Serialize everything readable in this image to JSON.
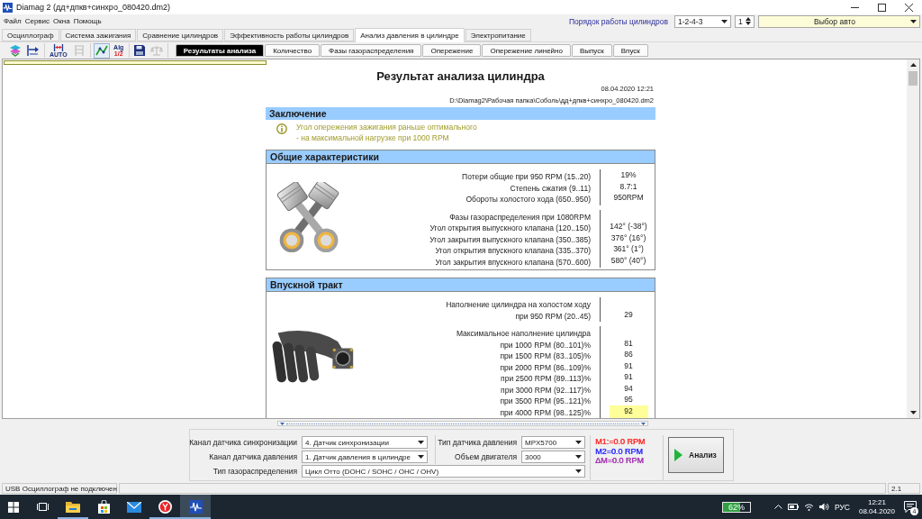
{
  "window": {
    "title": "Diamag 2 (дд+дпкв+синхро_080420.dm2)"
  },
  "menu": [
    {
      "label": "Файл"
    },
    {
      "label": "Сервис"
    },
    {
      "label": "Окна"
    },
    {
      "label": "Помощь"
    }
  ],
  "cylinder_order": {
    "label": "Порядок работы цилиндров",
    "order": "1-2-4-3",
    "cylinder": "1",
    "car": "Выбор авто"
  },
  "tabs": [
    {
      "label": "Осциллограф",
      "selected": false
    },
    {
      "label": "Система зажигания",
      "selected": false
    },
    {
      "label": "Сравнение цилиндров",
      "selected": false
    },
    {
      "label": "Эффективность работы цилиндров",
      "selected": false
    },
    {
      "label": "Анализ давления в цилиндре",
      "selected": true
    },
    {
      "label": "Электропитание",
      "selected": false
    }
  ],
  "toolbar": [
    {
      "buttons": [
        {
          "kind": "layers",
          "disabled": false,
          "pressed": false
        },
        {
          "kind": "arrow",
          "disabled": false,
          "pressed": false
        }
      ]
    },
    {
      "buttons": [
        {
          "kind": "auto",
          "captions": [
            "AUTO"
          ],
          "disabled": false,
          "pressed": false
        },
        {
          "kind": "grid",
          "disabled": true,
          "pressed": false
        }
      ]
    },
    {
      "buttons": [
        {
          "kind": "chart",
          "disabled": false,
          "pressed": true
        },
        {
          "kind": "algorithm",
          "captions": [
            "Alg",
            "1/2"
          ],
          "disabled": false,
          "pressed": false
        }
      ]
    },
    {
      "buttons": [
        {
          "kind": "save",
          "disabled": false,
          "pressed": false
        },
        {
          "kind": "scales",
          "disabled": true,
          "pressed": false
        }
      ]
    }
  ],
  "subtabs": [
    {
      "label": "Результаты анализа",
      "selected": true
    },
    {
      "label": "Количество",
      "selected": false
    },
    {
      "label": "Фазы газораспределения",
      "selected": false
    },
    {
      "label": "Опережение",
      "selected": false
    },
    {
      "label": "Опережение линейно",
      "selected": false
    },
    {
      "label": "Выпуск",
      "selected": false
    },
    {
      "label": "Впуск",
      "selected": false
    }
  ],
  "report": {
    "title": "Результат анализа цилиндра",
    "date": "08.04.2020 12:21",
    "path": "D:\\Diamag2\\Рабочая папка\\Соболь\\дд+дпкв+синхро_080420.dm2",
    "sections": [
      {
        "kind": "conclusion",
        "title": "Заключение",
        "lines": [
          "Угол опережения зажигания раньше оптимального",
          "- на максимальной нагрузке при 1000 RPM"
        ]
      },
      {
        "kind": "table",
        "title": "Общие характеристики",
        "illustration": {
          "kind": "pistons"
        },
        "groups": [
          {
            "rows": [
              {
                "label": "Потери общие при 950 RPM (15..20)",
                "value": "19%",
                "highlighted": false
              },
              {
                "label": "Степень сжатия (9..11)",
                "value": "8.7:1",
                "highlighted": false
              },
              {
                "label": "Обороты холостого хода (650..950)",
                "value": "950RPM",
                "highlighted": false
              }
            ]
          },
          {
            "rows": [
              {
                "label": "Фазы газораспределения при 1080RPM",
                "highlighted": false
              },
              {
                "label": "Угол открытия выпускного клапана (120..150)",
                "value": "142° (-38°)",
                "highlighted": false
              },
              {
                "label": "Угол закрытия выпускного клапана (350..385)",
                "value": "376° (16°)",
                "highlighted": false
              },
              {
                "label": "Угол открытия впускного клапана (335..370)",
                "value": "361° (1°)",
                "highlighted": false
              },
              {
                "label": "Угол закрытия впускного клапана (570..600)",
                "value": "580° (40°)",
                "highlighted": false
              }
            ]
          }
        ]
      },
      {
        "kind": "table",
        "title": "Впускной тракт",
        "illustration": {
          "kind": "manifold"
        },
        "groups": [
          {
            "rows": [
              {
                "label": "Наполнение цилиндра на холостом ходу",
                "highlighted": false
              },
              {
                "label": "при 950 RPM (20..45)",
                "value": "29",
                "highlighted": false
              }
            ]
          },
          {
            "rows": [
              {
                "label": "Максимальное наполнение цилиндра",
                "highlighted": false
              },
              {
                "label": "при 1000 RPM (80..101)%",
                "value": "81",
                "highlighted": false
              },
              {
                "label": "при 1500 RPM (83..105)%",
                "value": "86",
                "highlighted": false
              },
              {
                "label": "при 2000 RPM (86..109)%",
                "value": "91",
                "highlighted": false
              },
              {
                "label": "при 2500 RPM (89..113)%",
                "value": "91",
                "highlighted": false
              },
              {
                "label": "при 3000 RPM (92..117)%",
                "value": "94",
                "highlighted": false
              },
              {
                "label": "при 3500 RPM (95..121)%",
                "value": "95",
                "highlighted": false
              },
              {
                "label": "при 4000 RPM (98..125)%",
                "value": "92",
                "highlighted": true
              }
            ]
          }
        ]
      }
    ]
  },
  "settings": {
    "sync_channel": {
      "label": "Канал датчика синхронизации",
      "value": "4. Датчик синхронизации"
    },
    "pressure_channel": {
      "label": "Канал датчика давления",
      "value": "1. Датчик давления в цилиндре"
    },
    "timing_type": {
      "label": "Тип газораспределения",
      "value": "Цикл Отто (DOHC / SOHC / OHC / OHV)"
    },
    "sensor_type": {
      "label": "Тип датчика давления",
      "value": "MPX5700"
    },
    "engine_volume": {
      "label": "Объем двигателя",
      "value": "3000"
    }
  },
  "markers": [
    {
      "text": "M1:=0.0 RPM",
      "color": "#ff2a2a"
    },
    {
      "text": "M2=0.0 RPM",
      "color": "#2a2aff"
    },
    {
      "text": "ΔM=0.0 RPM",
      "color": "#a030b0"
    }
  ],
  "analyze_button": {
    "label": "Анализ"
  },
  "status_bar": {
    "connection": "USB Осциллограф не подключен",
    "version": "2.1"
  },
  "taskbar": {
    "apps": [
      {
        "kind": "explorer",
        "running": true,
        "active": false
      },
      {
        "kind": "store",
        "running": false,
        "active": false
      },
      {
        "kind": "mail",
        "running": false,
        "active": false
      },
      {
        "kind": "browser",
        "running": true,
        "active": false
      },
      {
        "kind": "diamag",
        "running": true,
        "active": true
      }
    ],
    "battery": {
      "text": "62%",
      "level": 0.62
    },
    "language": "РУС",
    "time": "12:21",
    "date": "08.04.2020",
    "notifications": "4"
  }
}
